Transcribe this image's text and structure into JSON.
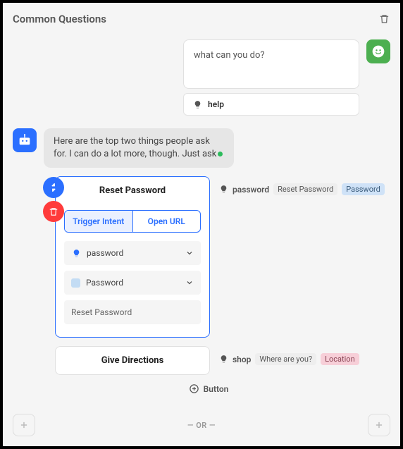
{
  "header": {
    "title": "Common Questions"
  },
  "user_message": {
    "text": "what can you do?"
  },
  "help_chip": {
    "label": "help"
  },
  "bot_message": {
    "text": "Here are the top two things people ask for. I can do a lot more, though. Just ask"
  },
  "reset_card": {
    "title": "Reset Password",
    "seg": {
      "trigger": "Trigger Intent",
      "open_url": "Open URL"
    },
    "field_password": "password",
    "field_entity": "Password",
    "field_plain": "Reset Password"
  },
  "reset_meta": {
    "label": "password",
    "pill1": "Reset Password",
    "pill2": "Password"
  },
  "directions_card": {
    "title": "Give Directions"
  },
  "directions_meta": {
    "label": "shop",
    "pill1": "Where are you?",
    "pill2": "Location"
  },
  "add_button": {
    "label": "Button"
  },
  "or_divider": {
    "label": "— OR —"
  }
}
